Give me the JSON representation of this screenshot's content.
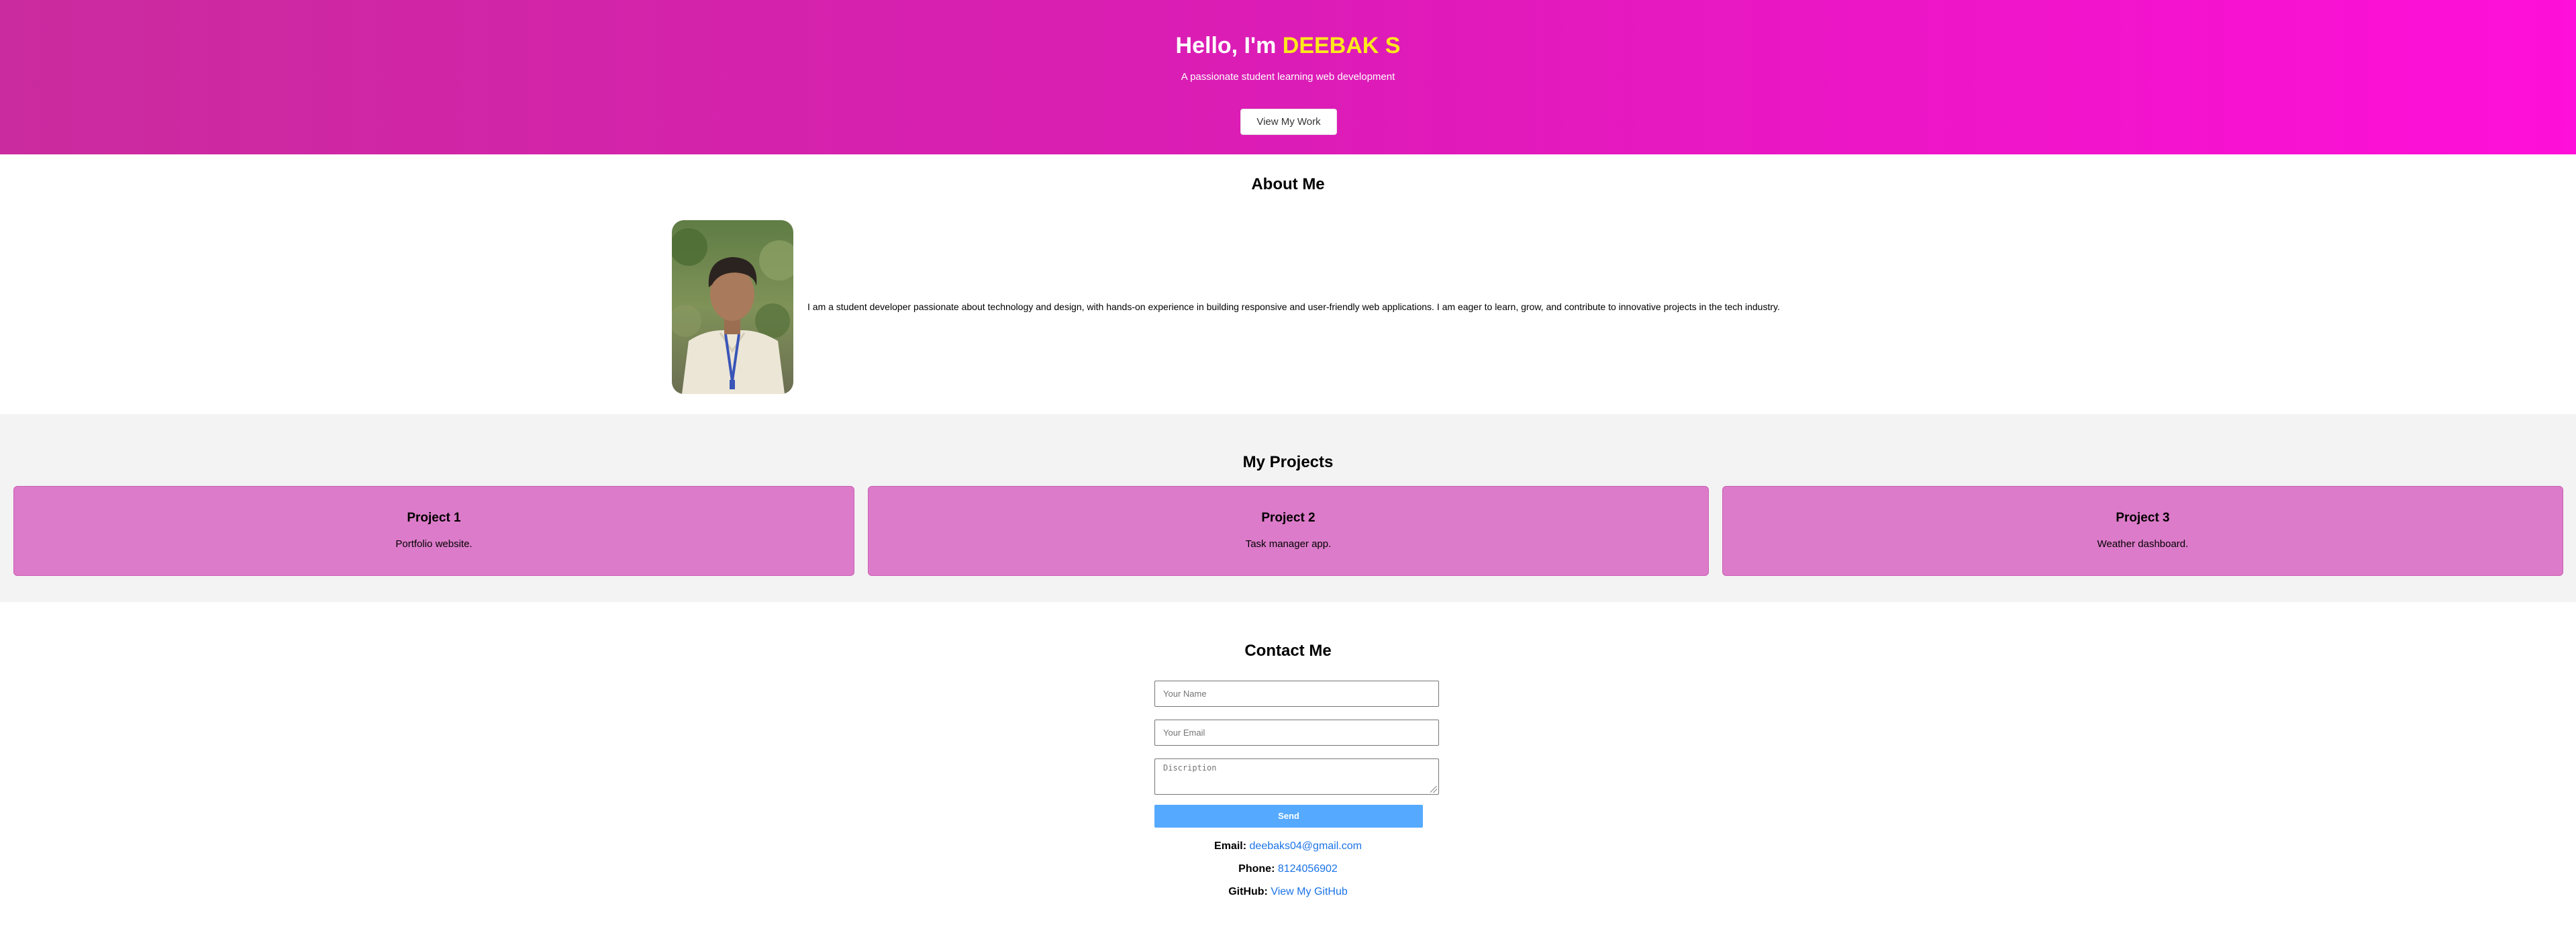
{
  "hero": {
    "greeting": "Hello, I'm",
    "name": "DEEBAK S",
    "subtitle": "A passionate student learning web development",
    "cta_label": "View My Work"
  },
  "about": {
    "heading": "About Me",
    "bio": "I am a student developer passionate about technology and design, with hands-on experience in building responsive and user-friendly web applications. I am eager to learn, grow, and contribute to innovative projects in the tech industry."
  },
  "projects": {
    "heading": "My Projects",
    "items": [
      {
        "title": "Project 1",
        "description": "Portfolio website."
      },
      {
        "title": "Project 2",
        "description": "Task manager app."
      },
      {
        "title": "Project 3",
        "description": "Weather dashboard."
      }
    ]
  },
  "contact": {
    "heading": "Contact Me",
    "name_placeholder": "Your Name",
    "email_placeholder": "Your Email",
    "description_placeholder": "Discription",
    "send_label": "Send",
    "email_label": "Email:",
    "email_value": "deebaks04@gmail.com",
    "phone_label": "Phone:",
    "phone_value": "8124056902",
    "github_label": "GitHub:",
    "github_value": "View My GitHub"
  },
  "colors": {
    "hero_gradient_start": "#ca2b9e",
    "hero_gradient_end": "#ff0fd9",
    "name_highlight": "#ffe81c",
    "project_card": "#dc7bc9",
    "send_button": "#55aaff",
    "link": "#1a73e8"
  }
}
